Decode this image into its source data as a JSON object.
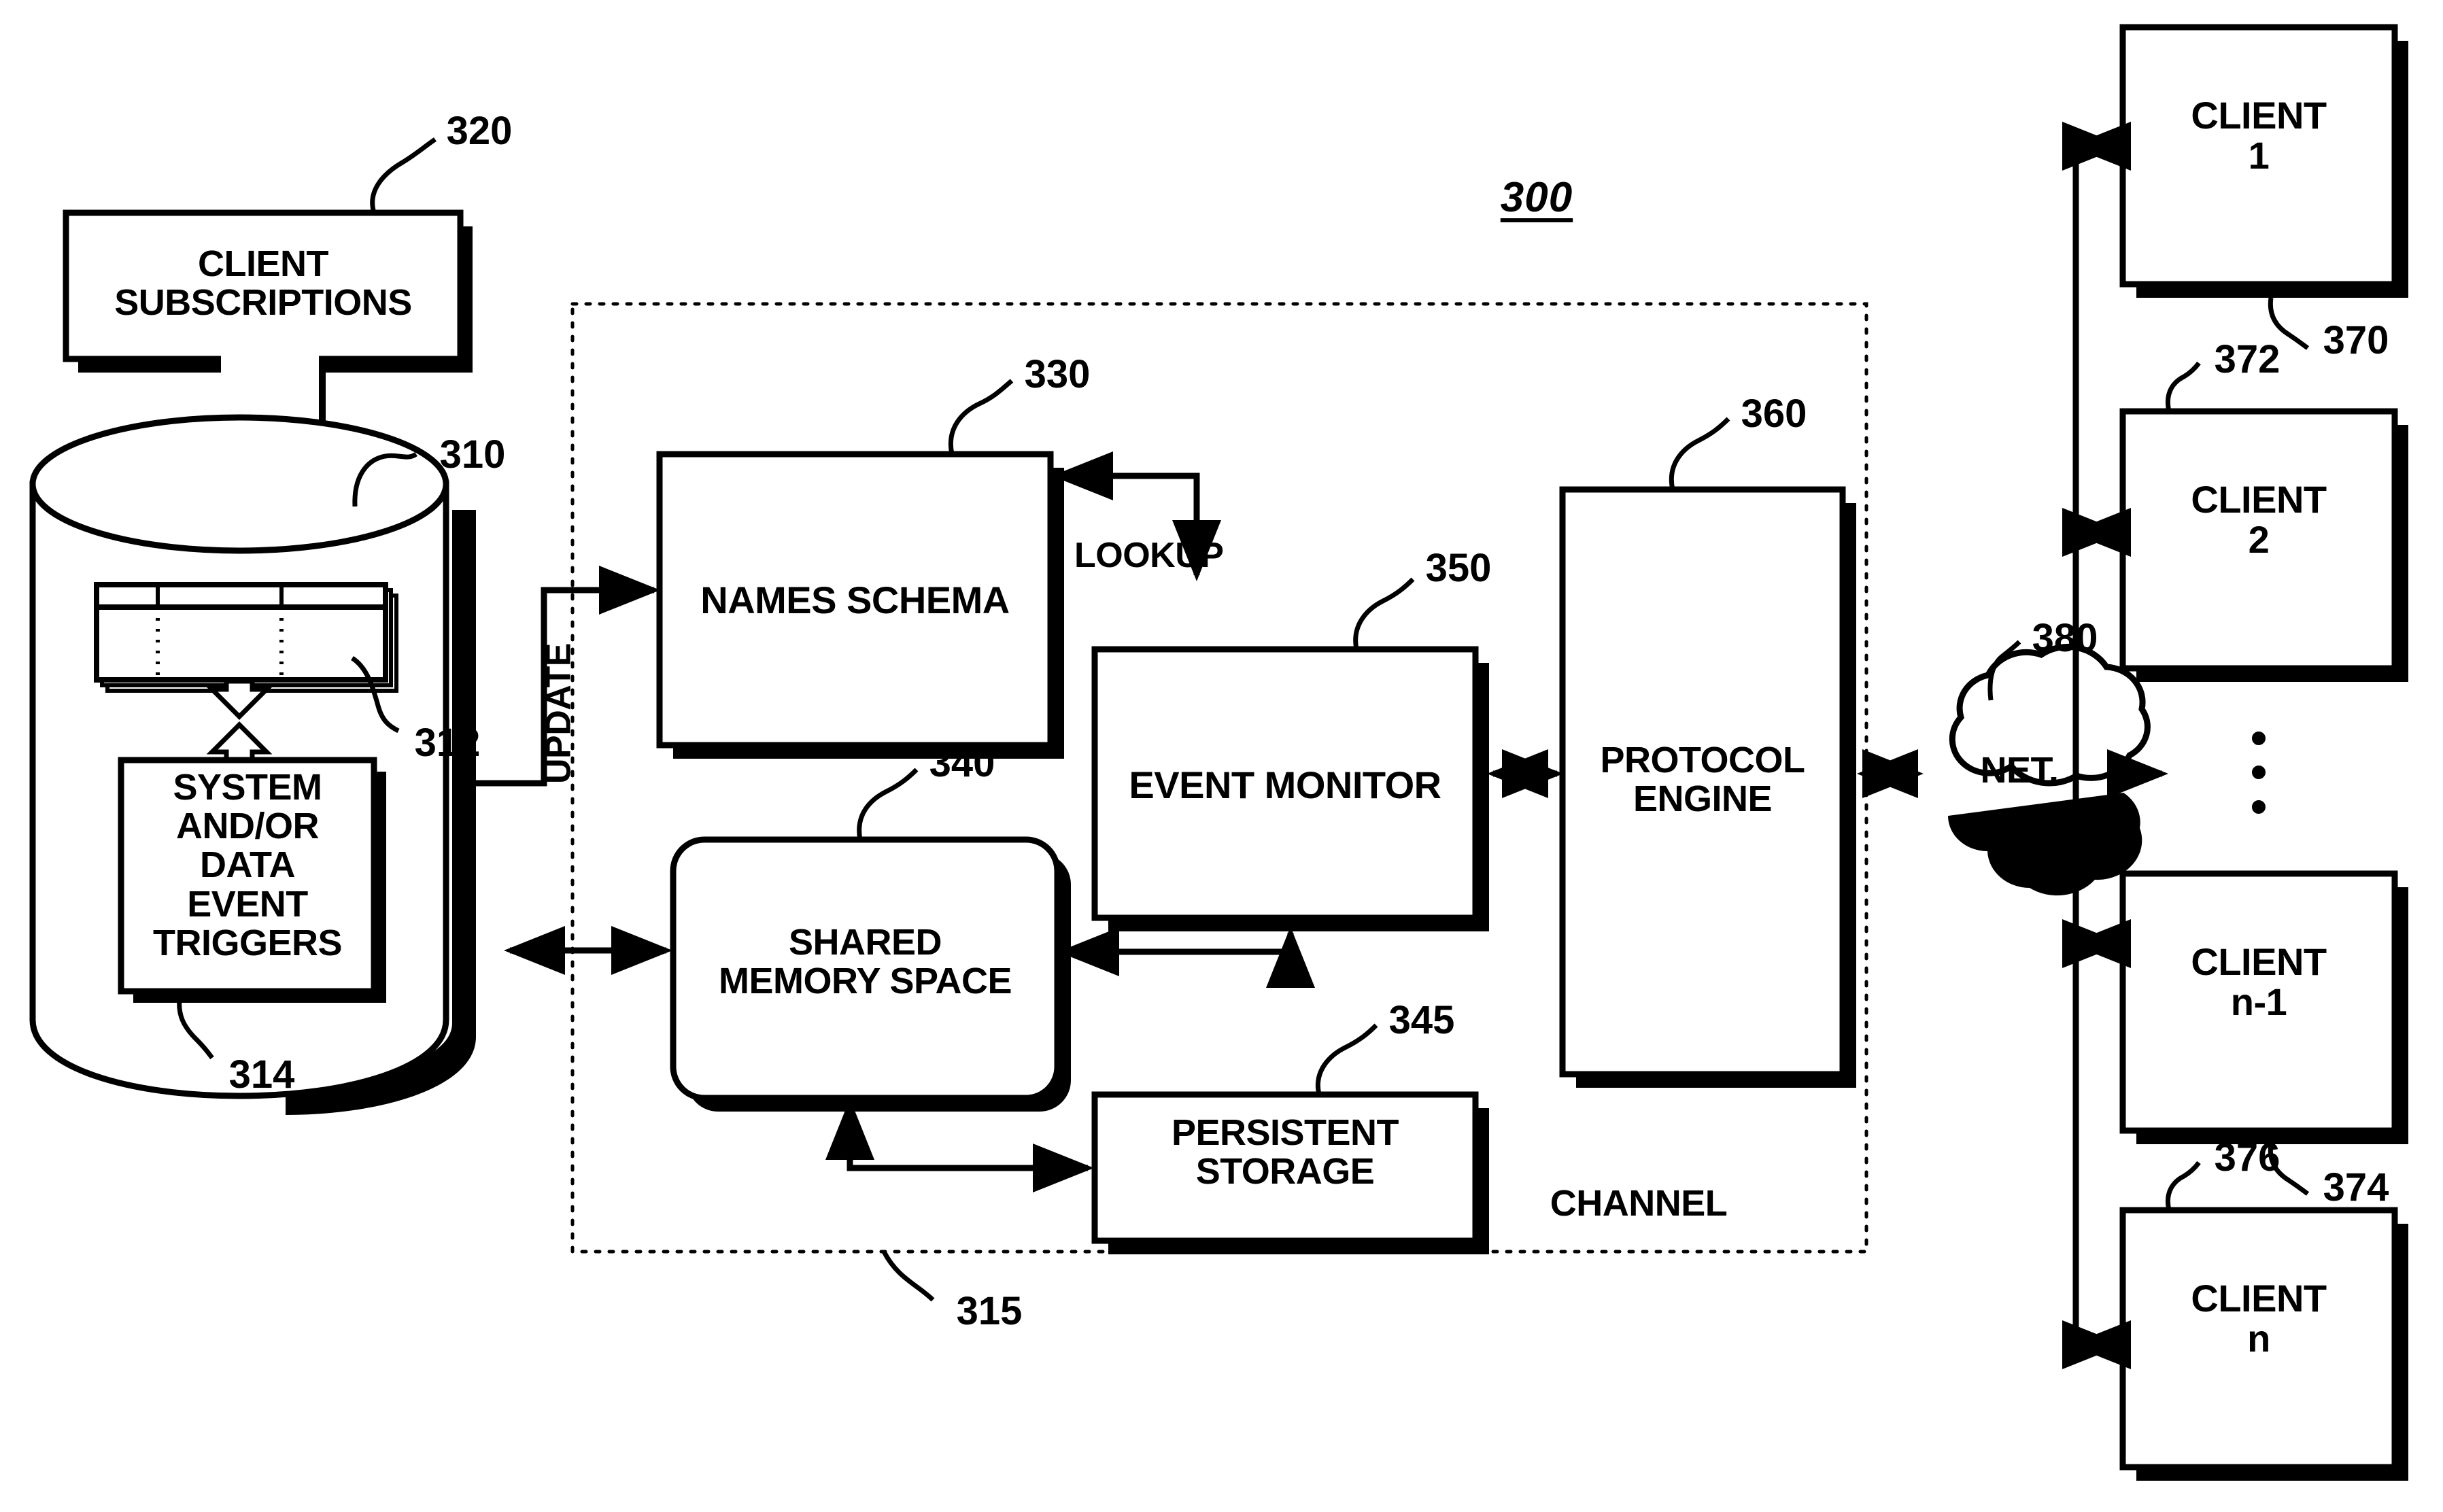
{
  "figure": {
    "id_label": "300",
    "channel_label": "CHANNEL"
  },
  "nodes": {
    "client_subscriptions": {
      "label": "CLIENT\nSUBSCRIPTIONS",
      "ref": "320"
    },
    "database": {
      "ref": "310"
    },
    "records": {
      "ref": "312"
    },
    "event_triggers": {
      "label": "SYSTEM\nAND/OR\nDATA\nEVENT\nTRIGGERS",
      "ref": "314"
    },
    "names_schema": {
      "label": "NAMES SCHEMA",
      "ref": "330"
    },
    "shared_memory": {
      "label": "SHARED\nMEMORY SPACE",
      "ref": "340"
    },
    "persistent_storage": {
      "label": "PERSISTENT\nSTORAGE",
      "ref": "345"
    },
    "event_monitor": {
      "label": "EVENT MONITOR",
      "ref": "350"
    },
    "protocol_engine": {
      "label": "PROTOCOL\nENGINE",
      "ref": "360"
    },
    "network": {
      "label": "NET.",
      "ref": "380"
    },
    "channel_boundary": {
      "ref": "315"
    }
  },
  "clients": [
    {
      "label": "CLIENT\n1",
      "ref": "370"
    },
    {
      "label": "CLIENT\n2",
      "ref": "372"
    },
    {
      "label": "CLIENT\nn-1",
      "ref": "374"
    },
    {
      "label": "CLIENT\nn",
      "ref": "376"
    }
  ],
  "client_ellipsis": "•\n•\n•",
  "flows": {
    "update": "UPDATE",
    "lookup": "LOOKUP"
  },
  "colors": {
    "stroke": "#000000",
    "fill": "#ffffff",
    "shadow": "#000000",
    "background": "#ffffff"
  }
}
